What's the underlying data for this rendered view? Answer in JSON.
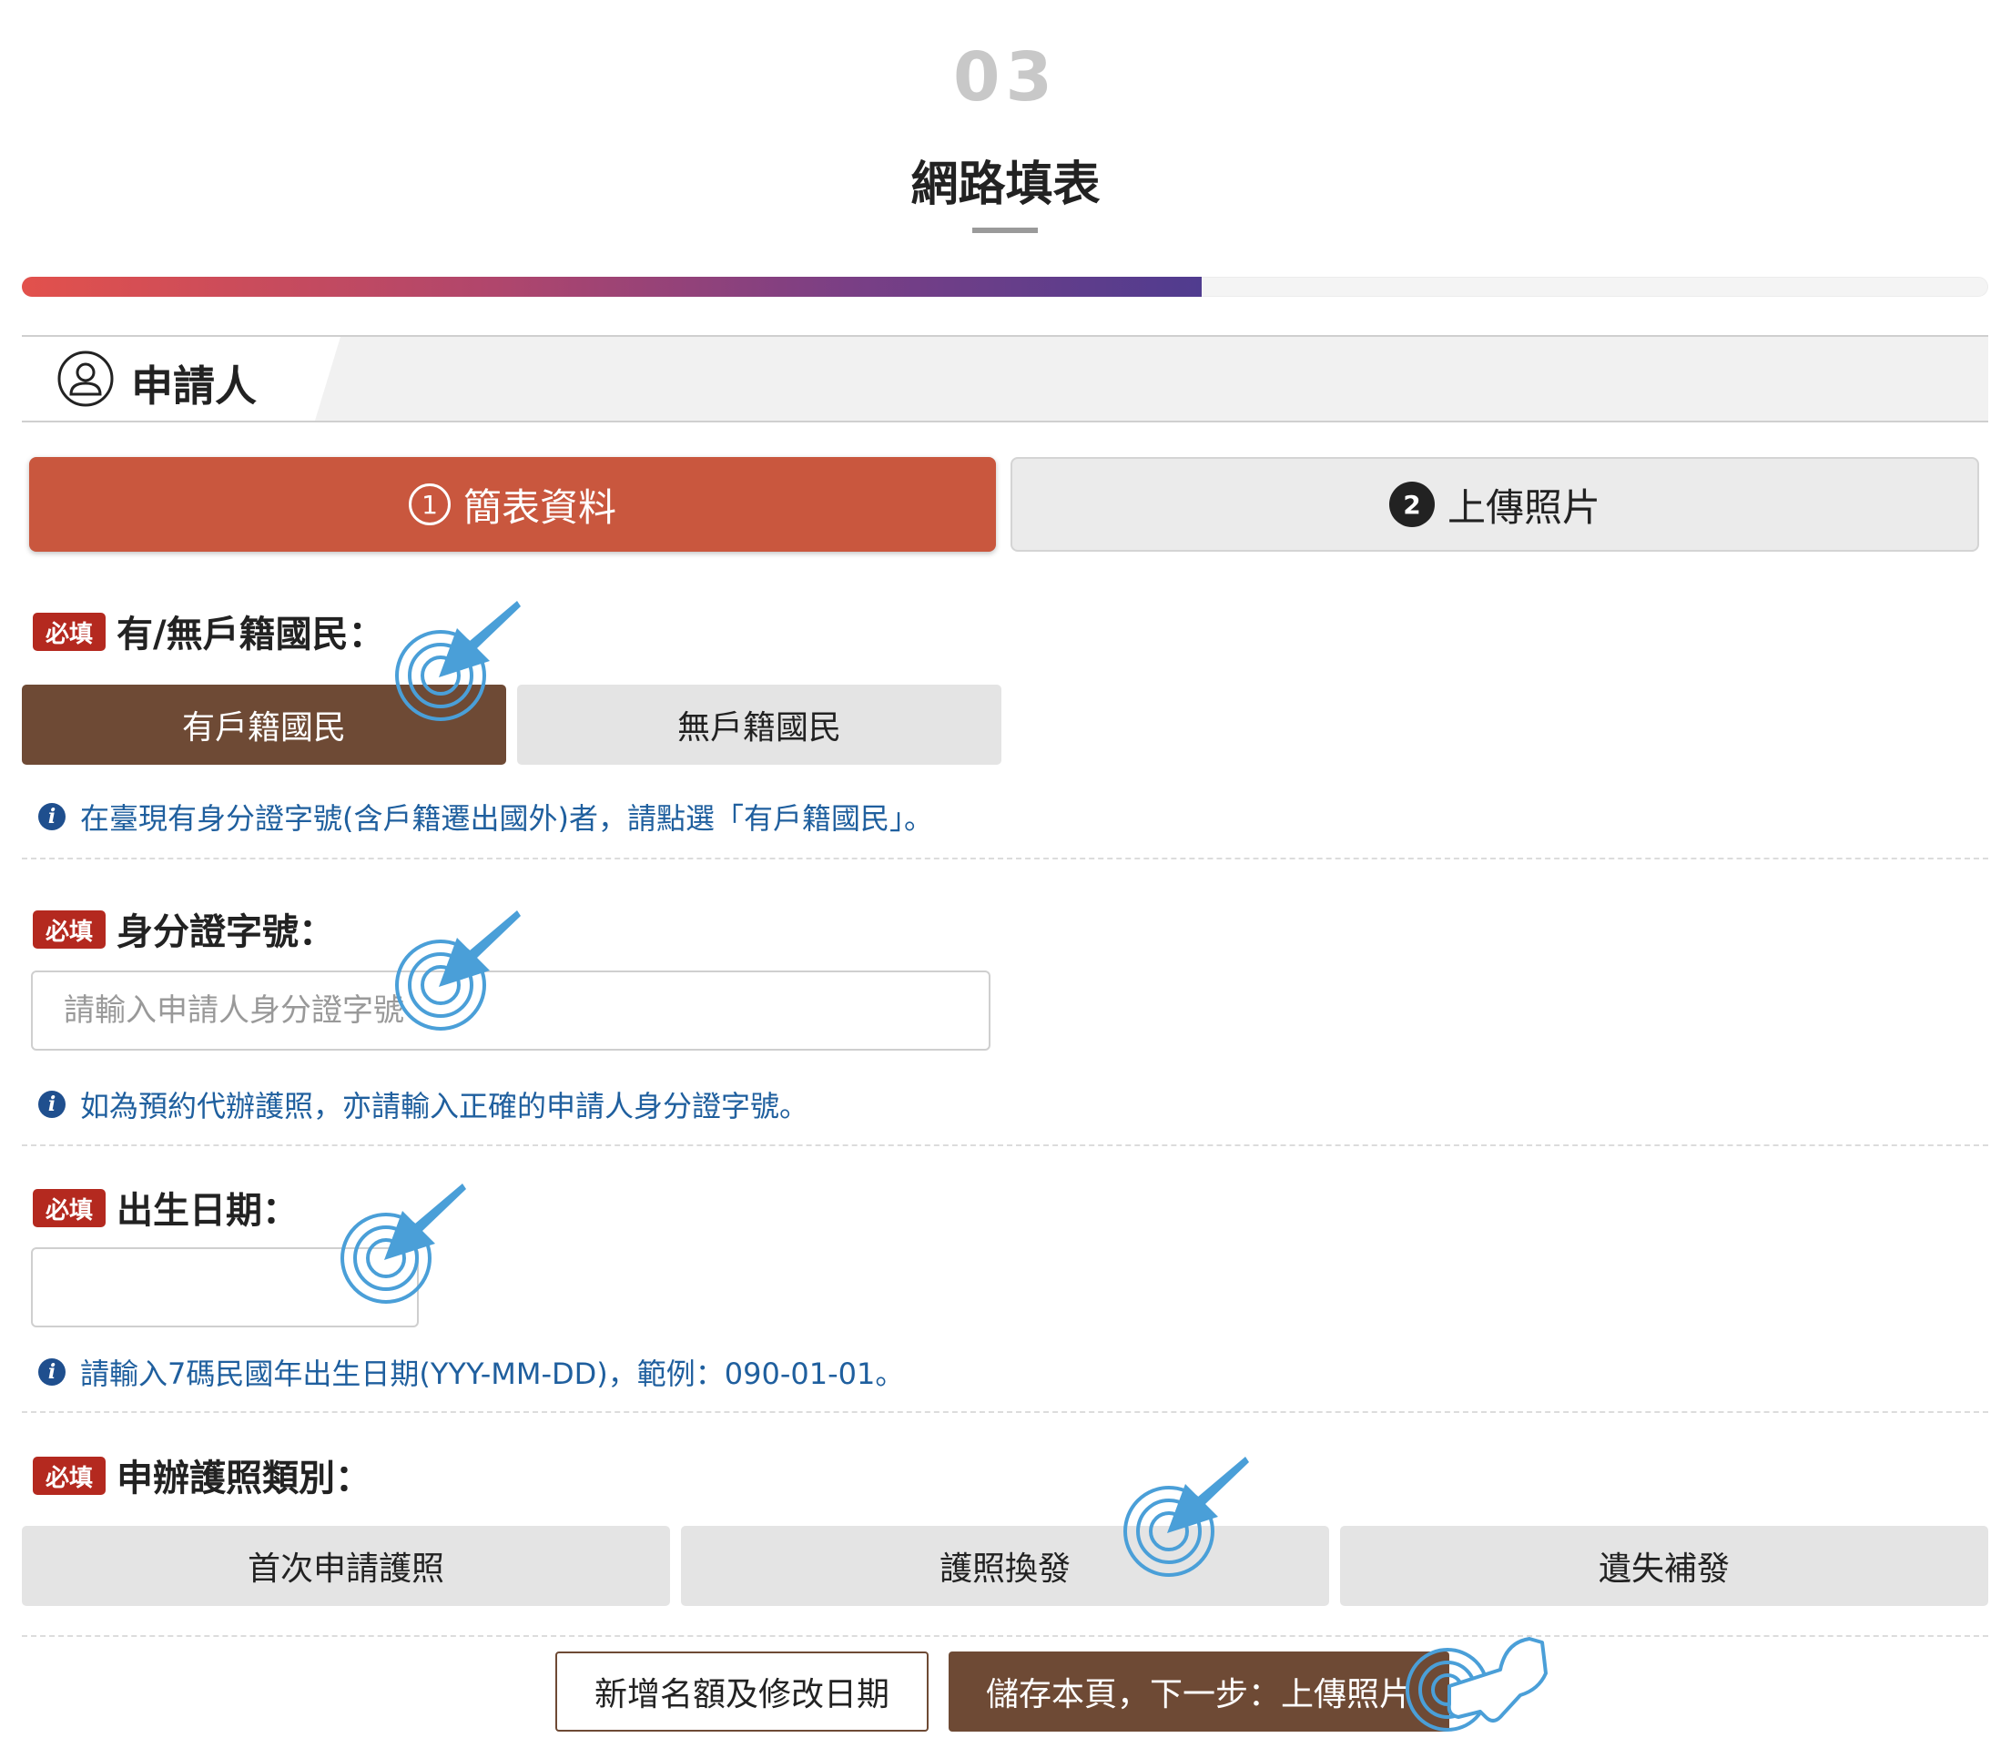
{
  "step": {
    "number": "03",
    "title": "網路填表"
  },
  "progress": {
    "fraction": 0.6
  },
  "section": {
    "label": "申請人",
    "icon": "user-icon"
  },
  "tabs": [
    {
      "num": "1",
      "label": "簡表資料",
      "active": true
    },
    {
      "num": "2",
      "label": "上傳照片",
      "active": false
    }
  ],
  "required_badge": "必填",
  "fields": {
    "citizenship": {
      "label": "有/無戶籍國民：",
      "options": [
        "有戶籍國民",
        "無戶籍國民"
      ],
      "selected": "有戶籍國民",
      "hint": "在臺現有身分證字號(含戶籍遷出國外)者，請點選「有戶籍國民」。"
    },
    "id_number": {
      "label": "身分證字號：",
      "placeholder": "請輸入申請人身分證字號",
      "value": "",
      "hint": "如為預約代辦護照，亦請輸入正確的申請人身分證字號。"
    },
    "birth_date": {
      "label": "出生日期：",
      "value": "",
      "hint": "請輸入7碼民國年出生日期(YYY-MM-DD)，範例：090-01-01。"
    },
    "passport_type": {
      "label": "申辦護照類別：",
      "options": [
        "首次申請護照",
        "護照換發",
        "遺失補發"
      ]
    }
  },
  "actions": {
    "secondary": "新增名額及修改日期",
    "primary": "儲存本頁，下一步：上傳照片"
  },
  "colors": {
    "tab_active": "#c9573e",
    "choice_selected": "#6e4a35",
    "required": "#b4291f",
    "hint": "#1f5f9e",
    "pointer_annotation": "#4a9fd8"
  }
}
